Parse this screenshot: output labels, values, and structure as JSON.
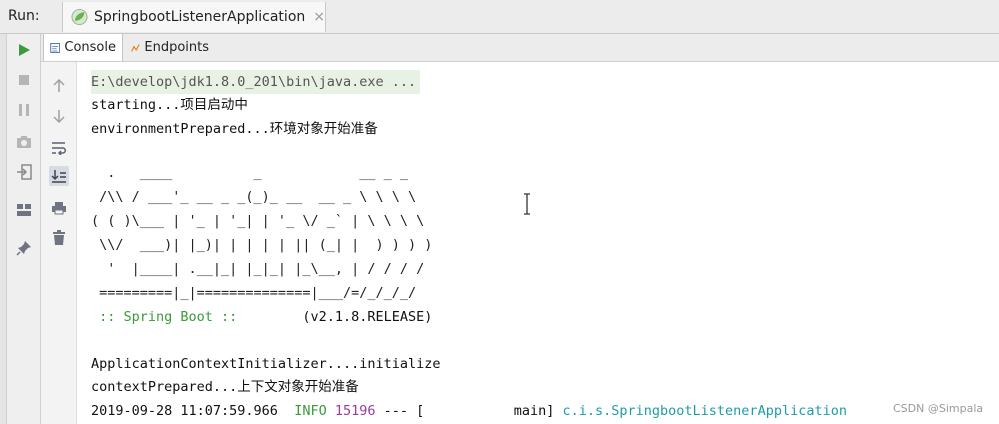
{
  "run": {
    "label": "Run:",
    "tab_title": "SpringbootListenerApplication",
    "close": "×"
  },
  "tabs": {
    "console": "Console",
    "endpoints": "Endpoints"
  },
  "console": {
    "cmd": "E:\\develop\\jdk1.8.0_201\\bin\\java.exe ...",
    "lines": [
      "starting...项目启动中",
      "environmentPrepared...环境对象开始准备"
    ],
    "banner": [
      "  .   ____          _            __ _ _",
      " /\\\\ / ___'_ __ _ _(_)_ __  __ _ \\ \\ \\ \\",
      "( ( )\\___ | '_ | '_| | '_ \\/ _` | \\ \\ \\ \\",
      " \\\\/  ___)| |_)| | | | | || (_| |  ) ) ) )",
      "  '  |____| .__|_| |_|_| |_\\__, | / / / /",
      " =========|_|==============|___/=/_/_/_/"
    ],
    "spring_boot": " :: Spring Boot ::",
    "version": "(v2.1.8.RELEASE)",
    "after": [
      "ApplicationContextInitializer....initialize",
      "contextPrepared...上下文对象开始准备"
    ],
    "log": {
      "timestamp": "2019-09-28 11:07:59.966",
      "level": "INFO",
      "pid": "15196",
      "sep": "---",
      "thread_open": "[",
      "thread": "main]",
      "logger": "c.i.s.SpringbootListenerApplication"
    }
  },
  "watermark": "CSDN @Simpala",
  "colors": {
    "green": "#3a9b3a",
    "purple": "#9b3aa0",
    "cyan": "#1e9da8"
  }
}
